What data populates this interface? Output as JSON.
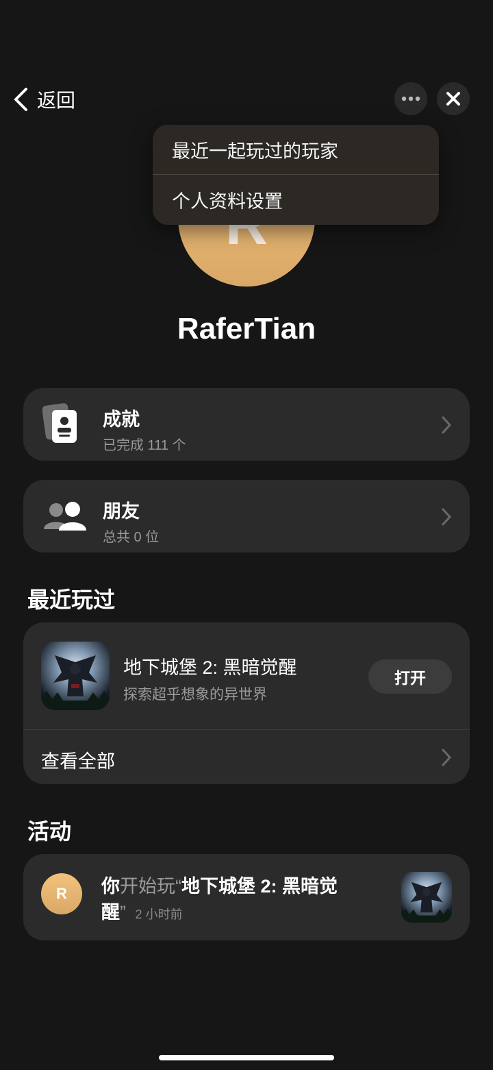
{
  "nav": {
    "back_label": "返回"
  },
  "menu": {
    "items": [
      {
        "label": "最近一起玩过的玩家"
      },
      {
        "label": "个人资料设置"
      }
    ]
  },
  "profile": {
    "avatar_letter": "R",
    "username": "RaferTian"
  },
  "achievements": {
    "title": "成就",
    "subtitle": "已完成 111 个"
  },
  "friends": {
    "title": "朋友",
    "subtitle": "总共 0 位"
  },
  "recent": {
    "section_title": "最近玩过",
    "game": {
      "name": "地下城堡 2: 黑暗觉醒",
      "description": "探索超乎想象的异世界",
      "open_label": "打开"
    },
    "view_all_label": "查看全部"
  },
  "activity": {
    "section_title": "活动",
    "avatar_letter": "R",
    "subject": "你",
    "verb": "开始玩",
    "open_quote": "“",
    "game_name_line1": "地下城堡 2: 黑暗觉",
    "game_name_line2": "醒",
    "close_quote": "”",
    "time": "2 小时前"
  },
  "colors": {
    "background": "#161616",
    "card": "#2b2b2b",
    "avatar": "#e4b26f"
  }
}
